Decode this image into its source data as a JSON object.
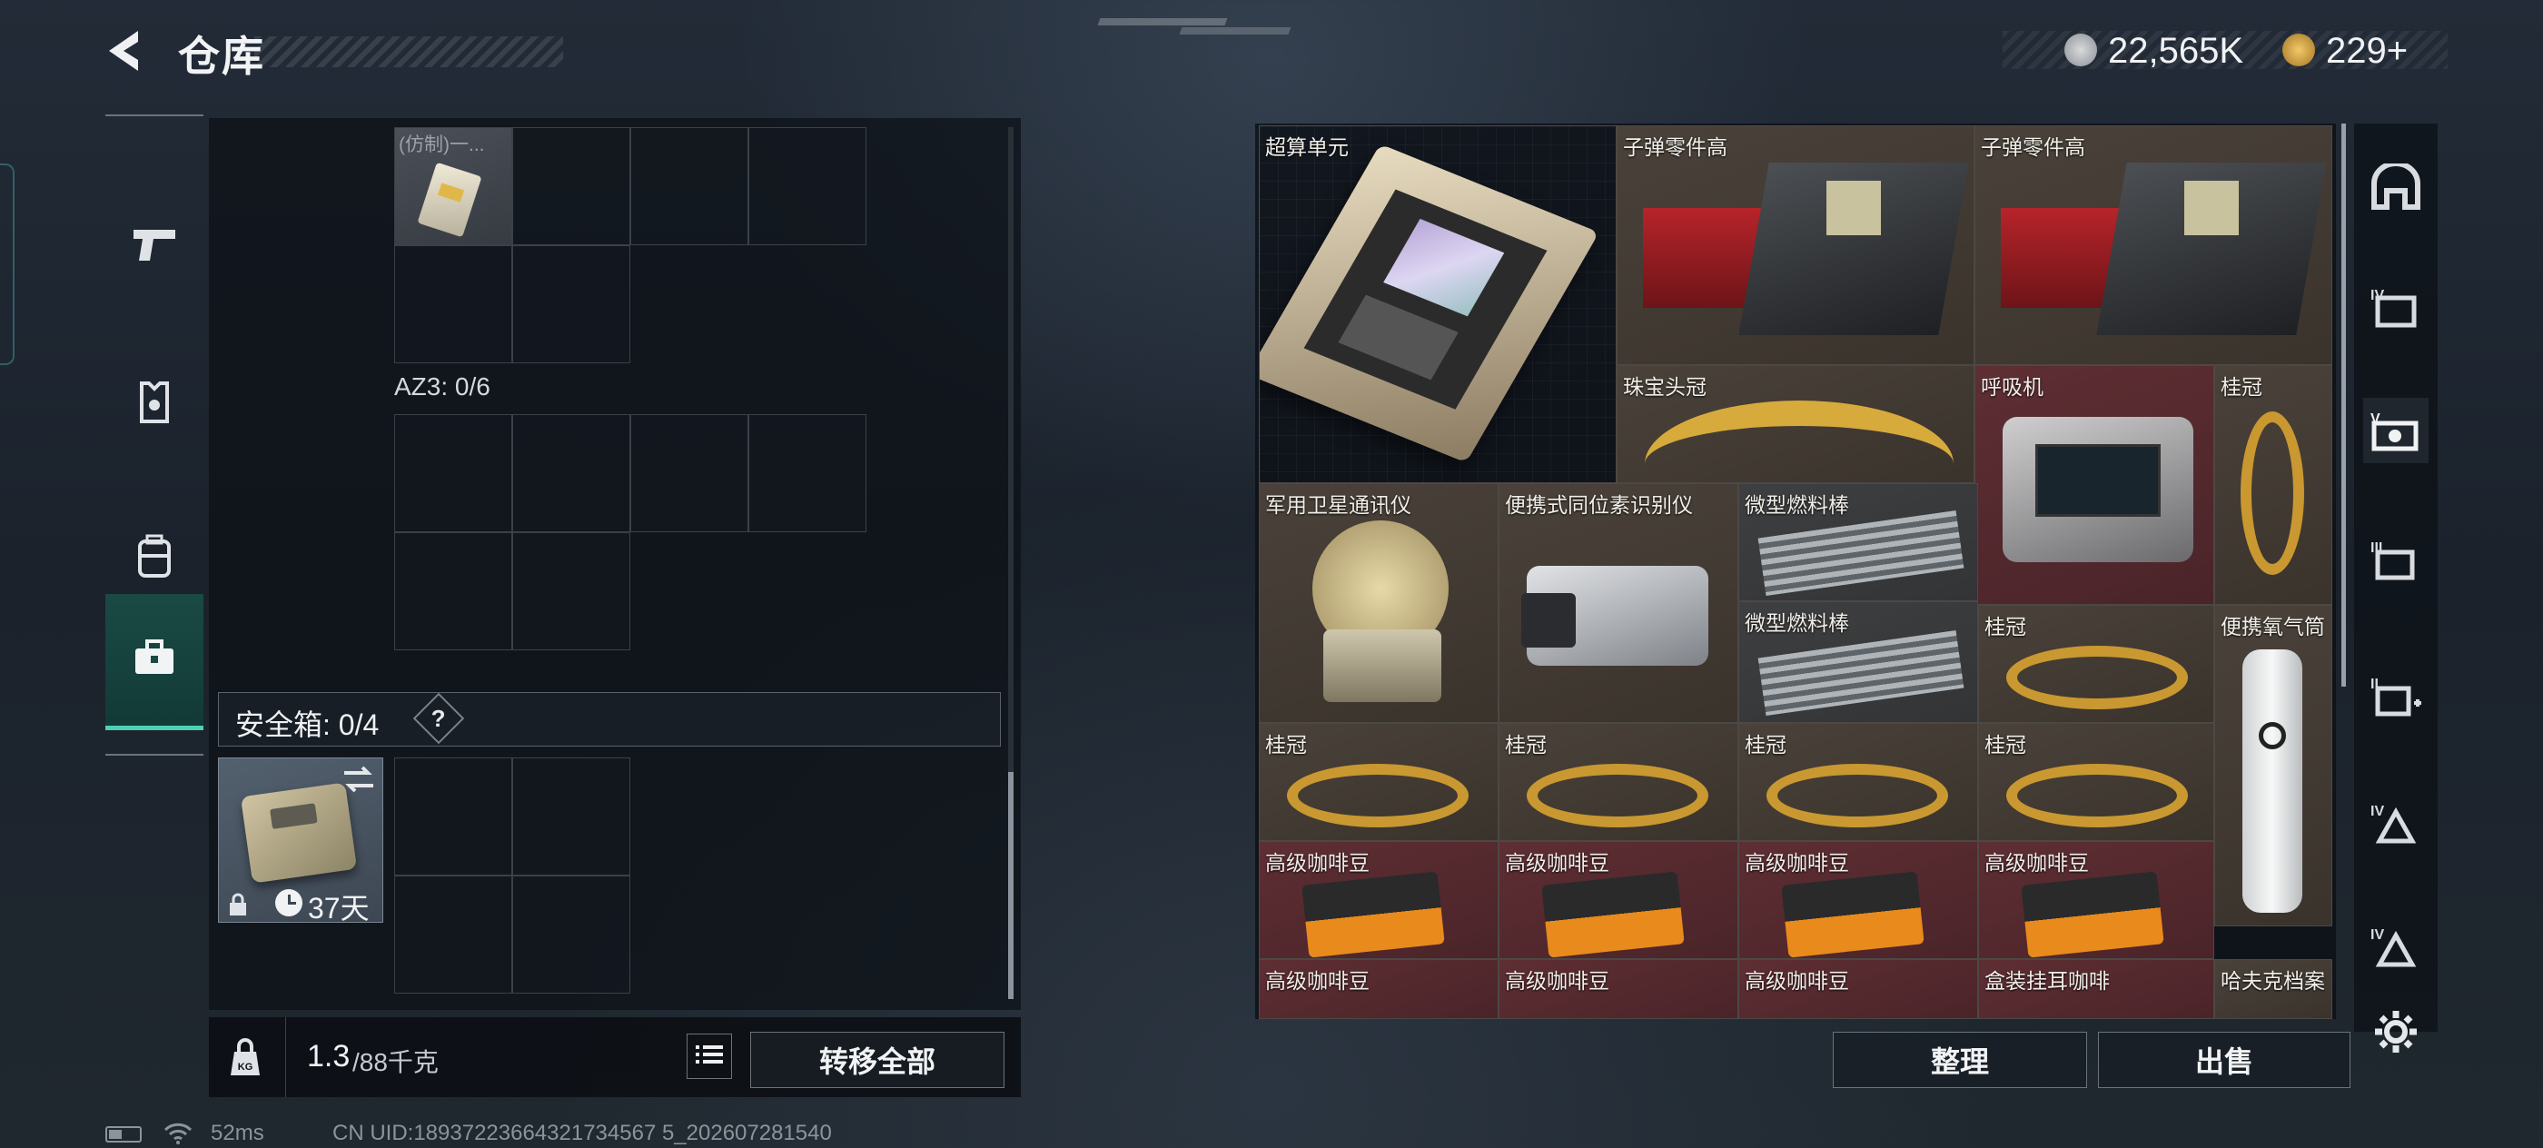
{
  "header": {
    "title": "仓库",
    "currency": [
      {
        "icon": "silver-coin-icon",
        "value": "22,565K"
      },
      {
        "icon": "gold-coin-icon",
        "value": "229+"
      }
    ]
  },
  "left_nav": [
    {
      "icon": "pistol-icon",
      "active": false
    },
    {
      "icon": "armor-vest-icon",
      "active": false
    },
    {
      "icon": "backpack-icon",
      "active": false
    },
    {
      "icon": "toolbox-icon",
      "active": true
    }
  ],
  "container": {
    "item_label": "(仿制)一...",
    "az3_label": "AZ3: 0/6",
    "safebox_label": "安全箱: 0/4",
    "help_label": "?",
    "safebox_item_days": "37天",
    "weight_current": "1.3",
    "weight_total": "/88千克",
    "transfer_all": "转移全部"
  },
  "stash": {
    "items": [
      {
        "name": "超算单元",
        "bg": "red"
      },
      {
        "name": "子弹零件高",
        "bg": "brn"
      },
      {
        "name": "子弹零件高",
        "bg": "brn"
      },
      {
        "name": "珠宝头冠",
        "bg": "brn"
      },
      {
        "name": "呼吸机",
        "bg": "red"
      },
      {
        "name": "桂冠",
        "bg": "brn"
      },
      {
        "name": "军用卫星通讯仪",
        "bg": "brn"
      },
      {
        "name": "便携式同位素识别仪",
        "bg": "brn"
      },
      {
        "name": "微型燃料棒",
        "bg": "gry"
      },
      {
        "name": "微型燃料棒",
        "bg": "gry"
      },
      {
        "name": "桂冠",
        "bg": "brn"
      },
      {
        "name": "便携氧气筒",
        "bg": "brn"
      },
      {
        "name": "桂冠",
        "bg": "brn"
      },
      {
        "name": "桂冠",
        "bg": "brn"
      },
      {
        "name": "桂冠",
        "bg": "brn"
      },
      {
        "name": "桂冠",
        "bg": "brn"
      },
      {
        "name": "高级咖啡豆",
        "bg": "red"
      },
      {
        "name": "高级咖啡豆",
        "bg": "red"
      },
      {
        "name": "高级咖啡豆",
        "bg": "red"
      },
      {
        "name": "高级咖啡豆",
        "bg": "red"
      },
      {
        "name": "高级咖啡豆",
        "bg": "red"
      },
      {
        "name": "高级咖啡豆",
        "bg": "red"
      },
      {
        "name": "高级咖啡豆",
        "bg": "red"
      },
      {
        "name": "盒装挂耳咖啡",
        "bg": "red"
      },
      {
        "name": "哈夫克档案",
        "bg": "brn"
      }
    ],
    "sort_label": "整理",
    "sell_label": "出售"
  },
  "right_rail": [
    "vault-icon",
    "folder-iv-icon",
    "scan-v-icon",
    "tag-iii-icon",
    "medkit-ii-icon",
    "shield-iv-icon",
    "shield-iv-icon-2",
    "settings-icon"
  ],
  "status": {
    "ping": "52ms",
    "uid": "CN UID:18937223664321734567 5_202607281540"
  },
  "colors": {
    "accent": "#4fd0b4",
    "red_item": "#5e2e33",
    "brown_item": "#4a423a"
  }
}
